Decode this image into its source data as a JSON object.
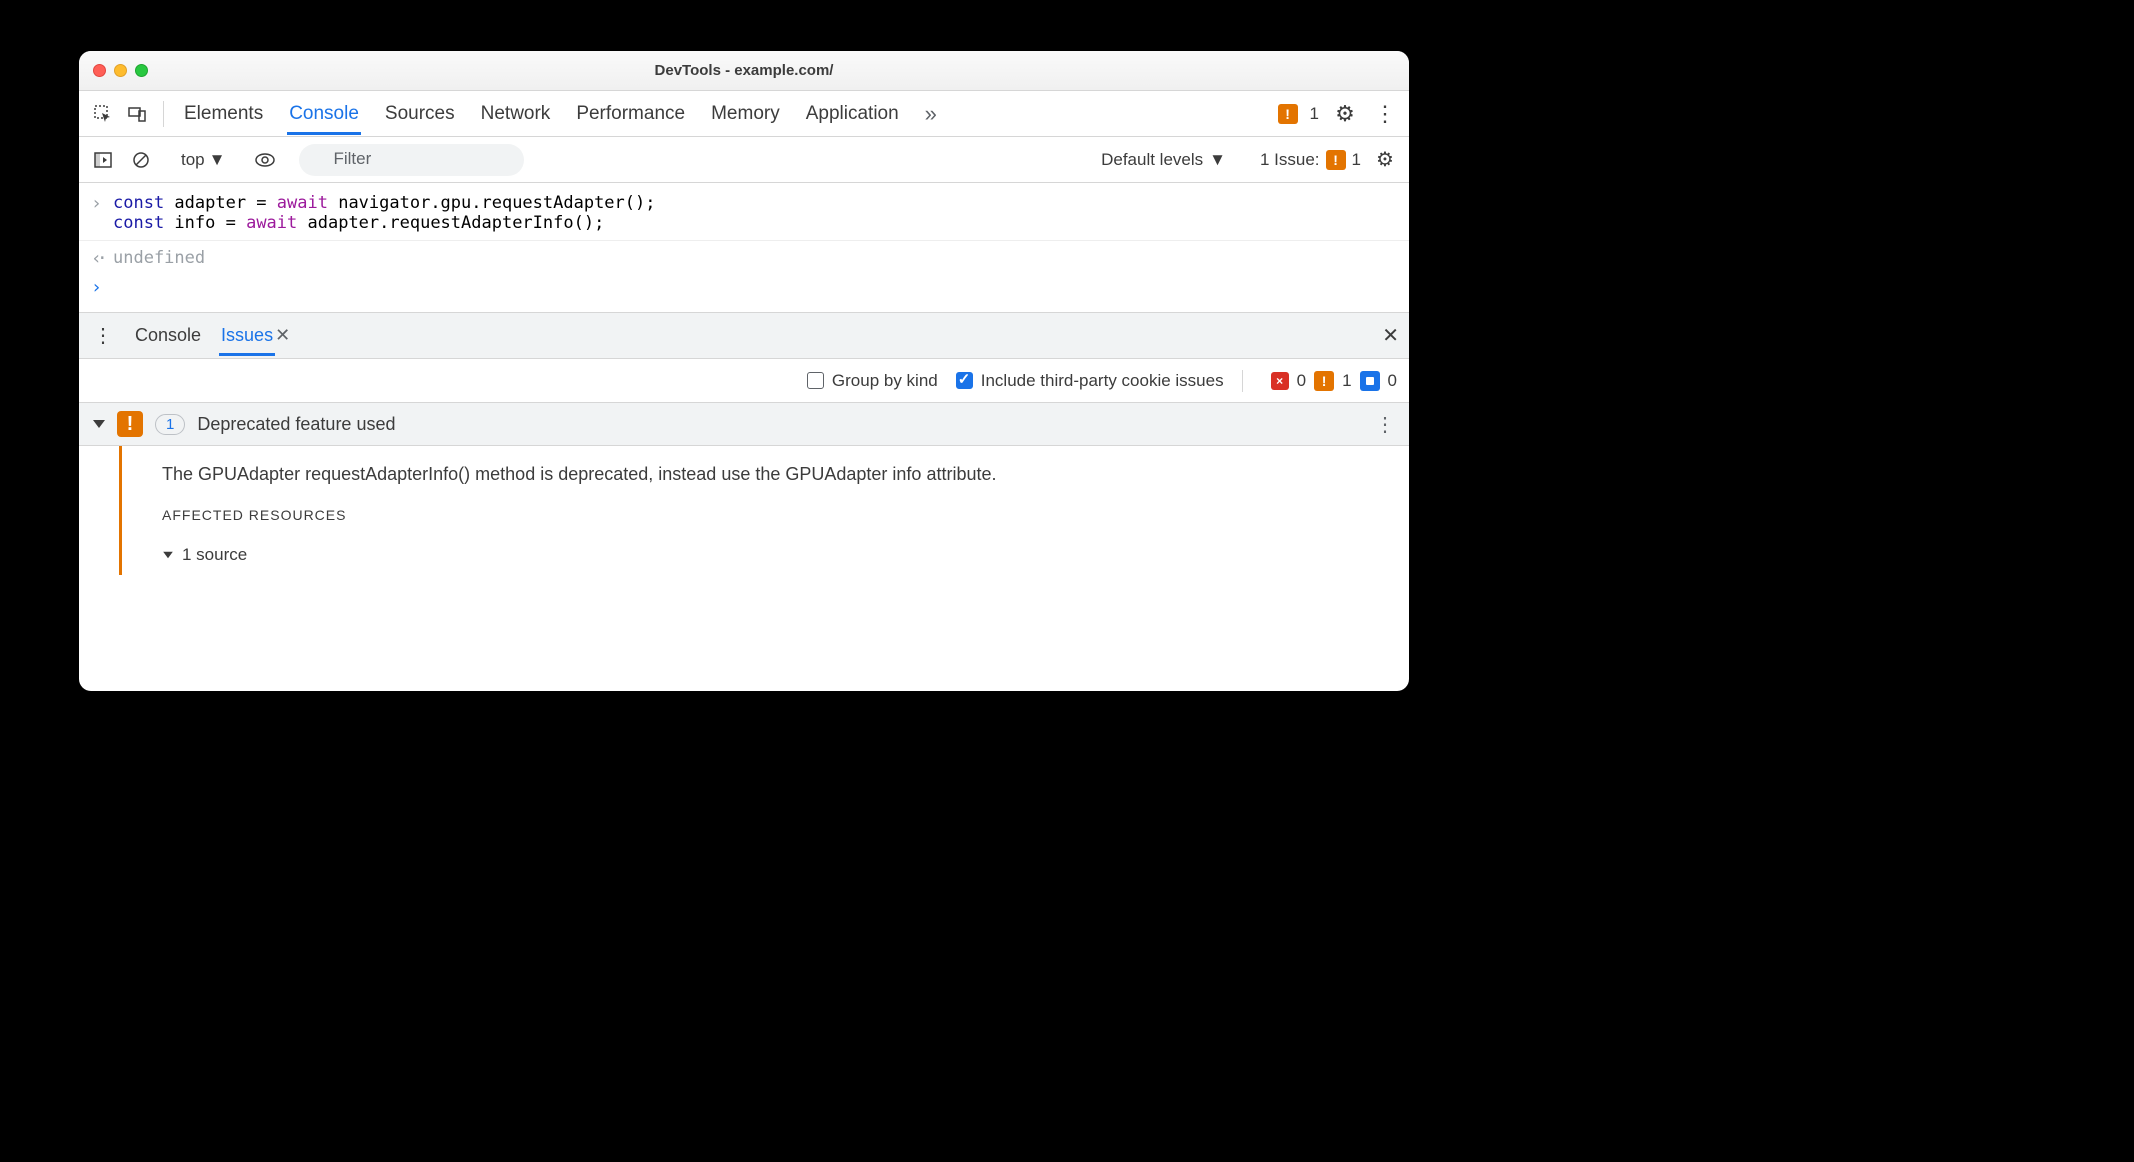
{
  "window": {
    "title": "DevTools - example.com/"
  },
  "toolbar": {
    "tabs": [
      "Elements",
      "Console",
      "Sources",
      "Network",
      "Performance",
      "Memory",
      "Application"
    ],
    "active": "Console",
    "overflow": "»",
    "warn_count": "1"
  },
  "subbar": {
    "context": "top",
    "filter_placeholder": "Filter",
    "levels": "Default levels",
    "issue_label": "1 Issue:",
    "issue_count": "1"
  },
  "console": {
    "input_lines": [
      {
        "tokens": [
          [
            "k-const",
            "const "
          ],
          [
            "",
            "adapter = "
          ],
          [
            "k-await",
            "await "
          ],
          [
            "",
            "navigator.gpu.requestAdapter();"
          ]
        ]
      },
      {
        "tokens": [
          [
            "k-const",
            "const "
          ],
          [
            "",
            "info = "
          ],
          [
            "k-await",
            "await "
          ],
          [
            "",
            "adapter.requestAdapterInfo();"
          ]
        ]
      }
    ],
    "output": "undefined"
  },
  "drawer": {
    "tabs": [
      "Console",
      "Issues"
    ],
    "active": "Issues"
  },
  "issues_bar": {
    "group_label": "Group by kind",
    "thirdparty_label": "Include third-party cookie issues",
    "group_checked": false,
    "thirdparty_checked": true,
    "error_count": "0",
    "warn_count": "1",
    "info_count": "0"
  },
  "issue": {
    "count": "1",
    "title": "Deprecated feature used",
    "message": "The GPUAdapter requestAdapterInfo() method is deprecated, instead use the GPUAdapter info attribute.",
    "affected_label": "AFFECTED RESOURCES",
    "source_label": "1 source"
  }
}
